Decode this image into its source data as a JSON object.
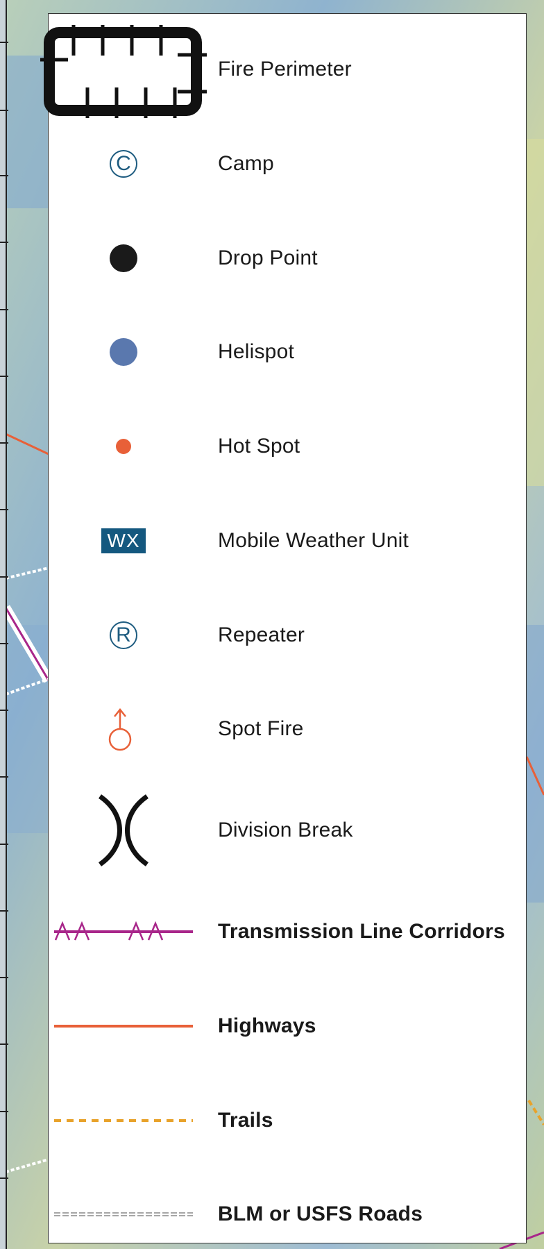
{
  "legend": {
    "items": [
      {
        "label": "Fire Perimeter",
        "icon": "fire-perimeter-icon",
        "bold": false
      },
      {
        "label": "Camp",
        "icon": "camp-icon",
        "glyph": "C",
        "bold": false
      },
      {
        "label": "Drop Point",
        "icon": "drop-point-icon",
        "bold": false
      },
      {
        "label": "Helispot",
        "icon": "helispot-icon",
        "bold": false
      },
      {
        "label": "Hot Spot",
        "icon": "hot-spot-icon",
        "bold": false
      },
      {
        "label": "Mobile Weather Unit",
        "icon": "mobile-weather-unit-icon",
        "glyph": "WX",
        "bold": false
      },
      {
        "label": "Repeater",
        "icon": "repeater-icon",
        "glyph": "R",
        "bold": false
      },
      {
        "label": "Spot Fire",
        "icon": "spot-fire-icon",
        "bold": false
      },
      {
        "label": "Division Break",
        "icon": "division-break-icon",
        "bold": false
      },
      {
        "label": "Transmission Line Corridors",
        "icon": "transmission-line-icon",
        "bold": true
      },
      {
        "label": "Highways",
        "icon": "highway-line-icon",
        "bold": true
      },
      {
        "label": "Trails",
        "icon": "trail-line-icon",
        "bold": true
      },
      {
        "label": "BLM or USFS Roads",
        "icon": "road-line-icon",
        "bold": true
      }
    ]
  },
  "colors": {
    "camp": "#1e5c80",
    "drop_point": "#1a1a1a",
    "helispot": "#5a78ae",
    "hot_spot": "#e86038",
    "weather_unit": "#14587f",
    "repeater": "#1e5c80",
    "spot_fire": "#e86038",
    "transmission": "#a8268a",
    "highway": "#e86038",
    "trail": "#e8a22a",
    "road": "#888888"
  }
}
